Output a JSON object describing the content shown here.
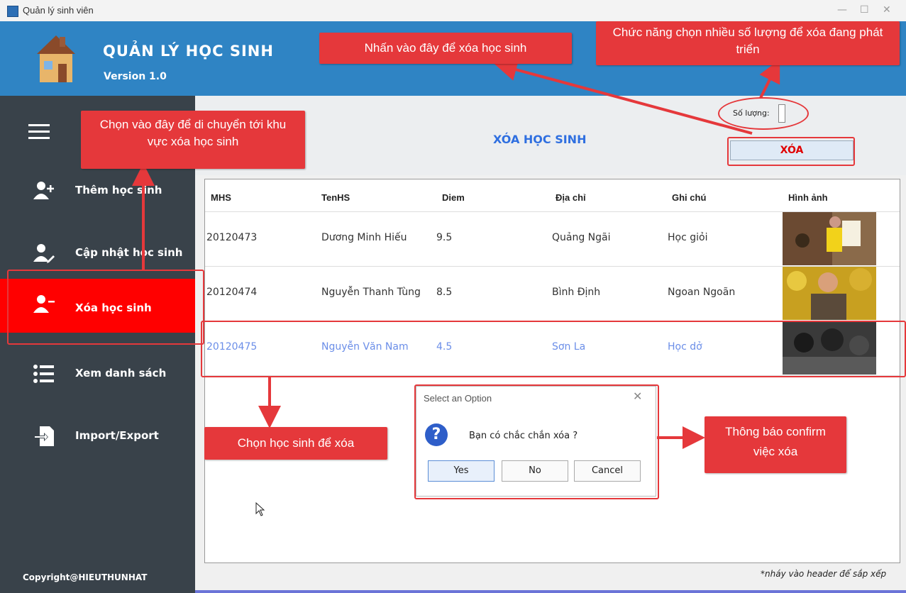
{
  "window": {
    "title": "Quản lý sinh viên"
  },
  "header": {
    "app_title": "QUẢN LÝ HỌC SINH",
    "version": "Version 1.0"
  },
  "sidebar": {
    "items": [
      {
        "label": "Thêm học sinh",
        "icon": "add-user-icon"
      },
      {
        "label": "Cập nhật học sinh",
        "icon": "edit-user-icon"
      },
      {
        "label": "Xóa học sinh",
        "icon": "remove-user-icon",
        "active": true
      },
      {
        "label": "Xem danh sách",
        "icon": "list-icon"
      },
      {
        "label": "Import/Export",
        "icon": "import-export-icon"
      }
    ],
    "copyright": "Copyright@HIEUTHUNHAT"
  },
  "main": {
    "page_title": "XÓA HỌC SINH",
    "qty_label": "Số lượng:",
    "delete_button": "XÓA",
    "hint": "*nháy vào header để sắp xếp"
  },
  "table": {
    "headers": [
      "MHS",
      "TenHS",
      "Diem",
      "Địa chỉ",
      "Ghi chú",
      "Hình ảnh"
    ],
    "rows": [
      {
        "mhs": "20120473",
        "ten": "Dương Minh Hiếu",
        "diem": "9.5",
        "dia_chi": "Quảng Ngãi",
        "ghi_chu": "Học giỏi"
      },
      {
        "mhs": "20120474",
        "ten": "Nguyễn Thanh Tùng",
        "diem": "8.5",
        "dia_chi": "Bình Định",
        "ghi_chu": "Ngoan Ngoãn"
      },
      {
        "mhs": "20120475",
        "ten": "Nguyễn Văn Nam",
        "diem": "4.5",
        "dia_chi": "Sơn La",
        "ghi_chu": "Học dở",
        "selected": true
      }
    ]
  },
  "dialog": {
    "title": "Select an Option",
    "message": "Bạn có chắc chắn xóa ?",
    "yes": "Yes",
    "no": "No",
    "cancel": "Cancel"
  },
  "annotations": {
    "delete_click": "Nhấn vào đây để xóa học sinh",
    "multi_select": "Chức năng chọn nhiều số lượng để xóa đang phát triển",
    "navigate": "Chọn vào đây để di chuyển tới khu vực xóa học sinh",
    "choose_student": "Chọn học sinh để xóa",
    "confirm": "Thông báo confirm việc xóa"
  },
  "colors": {
    "header": "#2f84c4",
    "sidebar": "#39424a",
    "active": "#ff0000",
    "annotation": "#e5383b",
    "accent": "#2f6fe0"
  }
}
